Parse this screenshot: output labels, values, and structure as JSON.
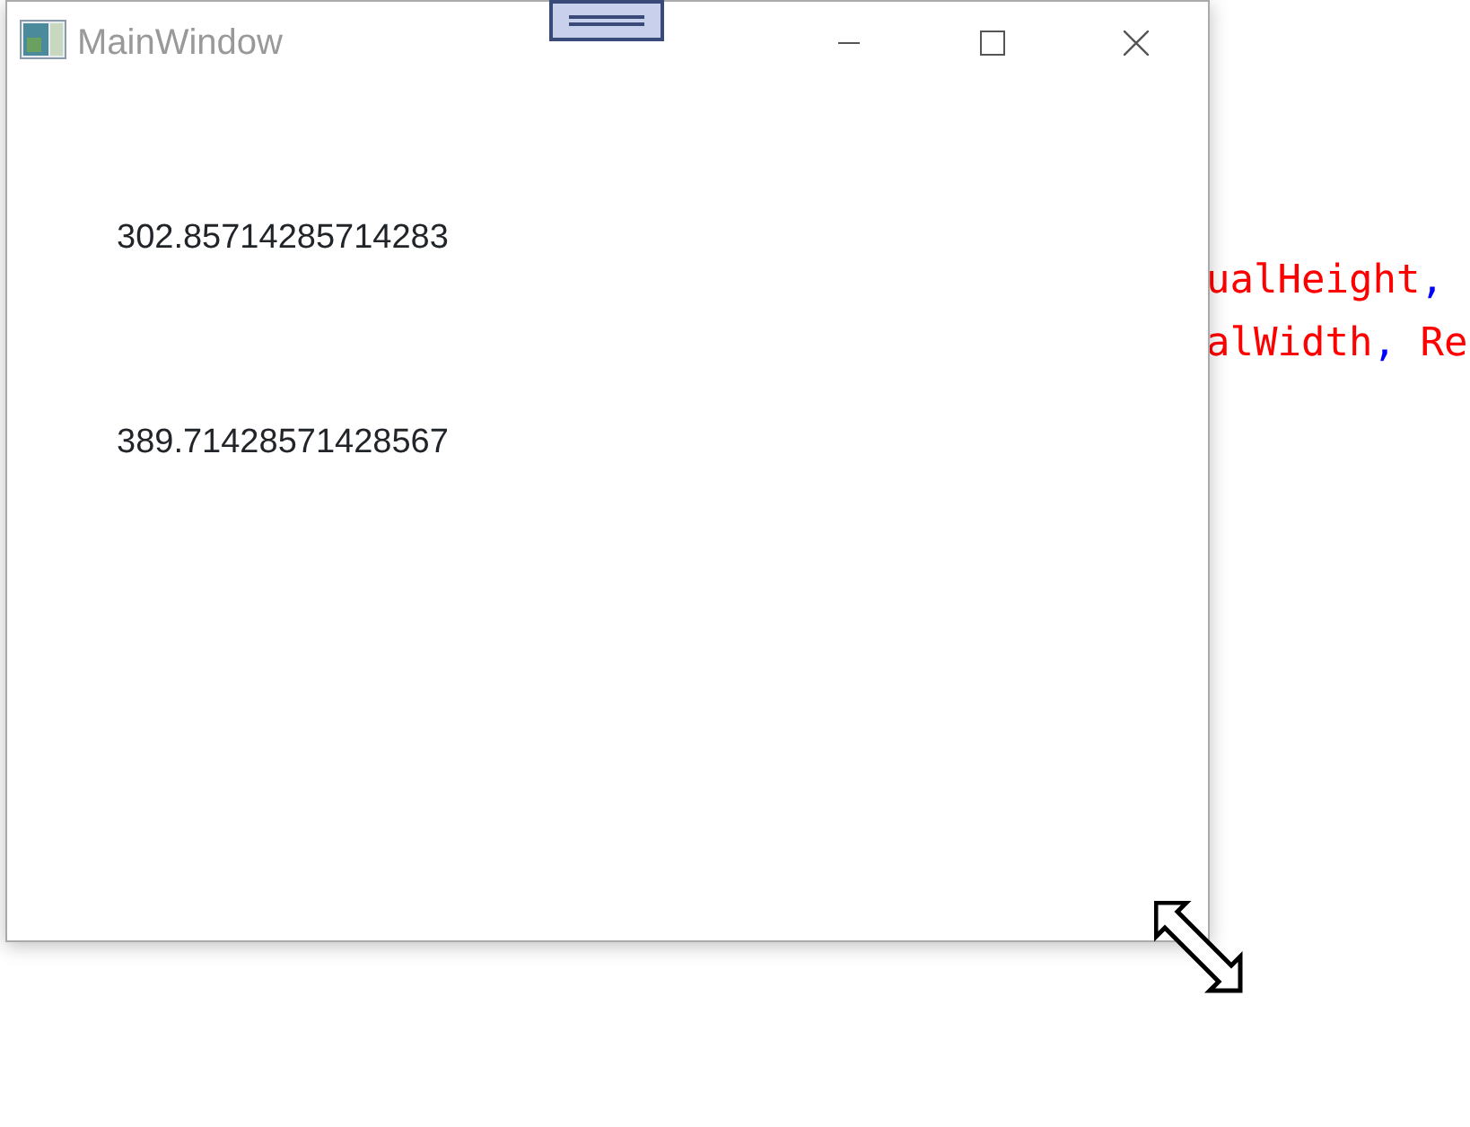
{
  "background_code": [
    {
      "tokens": [
        {
          "text": "ualHeight",
          "kind": "identifier"
        },
        {
          "text": ",",
          "kind": "punctuation"
        }
      ]
    },
    {
      "tokens": [
        {
          "text": "alWidth",
          "kind": "identifier"
        },
        {
          "text": ",",
          "kind": "punctuation"
        },
        {
          "text": " Re",
          "kind": "identifier"
        }
      ]
    }
  ],
  "window": {
    "title": "MainWindow",
    "active": false,
    "values": [
      "302.85714285714283",
      "389.71428571428567"
    ]
  }
}
